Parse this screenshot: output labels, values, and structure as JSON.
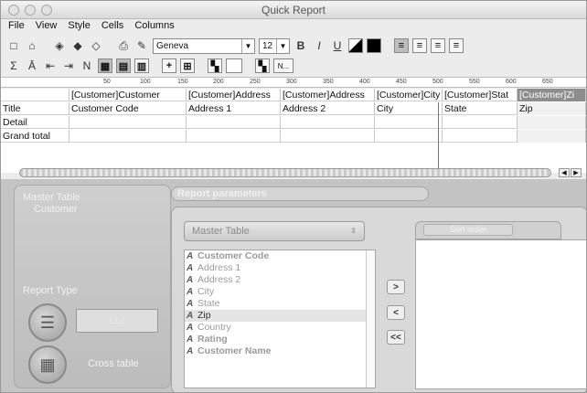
{
  "window": {
    "title": "Quick Report"
  },
  "menu": [
    "File",
    "View",
    "Style",
    "Cells",
    "Columns"
  ],
  "toolbar": {
    "font": "Geneva",
    "size": "12",
    "bold": "B",
    "italic": "I",
    "underline": "U",
    "num_field": "N..."
  },
  "ruler": [
    "50",
    "100",
    "150",
    "200",
    "250",
    "300",
    "350",
    "400",
    "450",
    "500",
    "550",
    "600",
    "650"
  ],
  "columns": [
    "",
    "[Customer]Customer",
    "[Customer]Address",
    "[Customer]Address",
    "[Customer]City",
    "[Customer]Stat",
    "[Customer]Zi"
  ],
  "rows": [
    {
      "label": "Title",
      "cells": [
        "Customer Code",
        "Address 1",
        "Address 2",
        "City",
        "State",
        "Zip"
      ]
    },
    {
      "label": "Detail",
      "cells": [
        "",
        "",
        "",
        "",
        "",
        ""
      ]
    },
    {
      "label": "Grand total",
      "cells": [
        "",
        "",
        "",
        "",
        "",
        ""
      ]
    }
  ],
  "left_panel": {
    "master_label": "Master Table",
    "master_value": "Customer",
    "report_type_label": "Report Type",
    "list_label": "List",
    "cross_label": "Cross table"
  },
  "params": {
    "title": "Report parameters",
    "master_table": "Master Table",
    "sort_order": "Sort order",
    "fields": [
      {
        "name": "Customer Code",
        "bold": true
      },
      {
        "name": "Address 1",
        "bold": false
      },
      {
        "name": "Address 2",
        "bold": false
      },
      {
        "name": "City",
        "bold": false
      },
      {
        "name": "State",
        "bold": false
      },
      {
        "name": "Zip",
        "bold": false,
        "selected": true
      },
      {
        "name": "Country",
        "bold": false
      },
      {
        "name": "Rating",
        "bold": true
      },
      {
        "name": "Customer Name",
        "bold": true
      }
    ],
    "add": ">",
    "remove": "<",
    "remove_all": "<<"
  },
  "colors": {
    "accent": "#c4c4c4"
  }
}
